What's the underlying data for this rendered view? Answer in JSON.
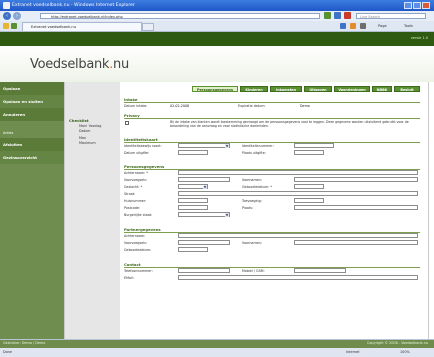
{
  "window": {
    "title": "Extranet voedselbank.nu - Windows Internet Explorer"
  },
  "address": {
    "url": "http://extranet.voedselbank.nl/index.php",
    "search_placeholder": "Live Search"
  },
  "tabs_browser": {
    "active": "Extranet voedselbank.nu"
  },
  "commands": {
    "page": "Page",
    "tools": "Tools"
  },
  "site": {
    "logo_main": "Voedselbank",
    "logo_dot": ".",
    "logo_tld": "nu",
    "version": "versie 1.0"
  },
  "sidebar": {
    "items": [
      {
        "label": "Opslaan"
      },
      {
        "label": "Opslaan en sluiten"
      },
      {
        "label": "Annuleren"
      },
      {
        "label": "Acties"
      },
      {
        "label": "Afsluiten"
      },
      {
        "label": "Gezinsoverzicht"
      }
    ]
  },
  "subpanel": {
    "heading": "Checklist",
    "items": [
      "Man! Voorlag",
      "Datum",
      "Man",
      "Maximum"
    ]
  },
  "main": {
    "tabs": [
      "Persoonsgegevens",
      "Kinderen",
      "Inkomsten",
      "Uitgaven",
      "Voorzieningen",
      "NBBK",
      "Besluit"
    ],
    "intake": {
      "title": "Intake",
      "date_label": "Datum intake:",
      "date_value": "02-02-2008",
      "expire_label": "Expiratie datum:",
      "expire_value": "Demo"
    },
    "privacy": {
      "title": "Privacy",
      "text": "Bij de intake van klanten wordt toestemming gevraagd om de persoonsgegevens vast te leggen. Deze gegevens worden uitsluitend gebruikt voor de beoordeling van de aanvraag en voor statistische doeleinden."
    },
    "identity": {
      "title": "Identiteitskaart",
      "kind_label": "Identiteitsbewijs soort:",
      "number_label": "Identiteitsnummer:",
      "issue_label": "Datum uitgifte:",
      "place_label": "Plaats uitgifte:"
    },
    "person": {
      "title": "Persoonsgegevens",
      "rows": [
        "Achternaam: *",
        "Voorvoegsels:",
        "Geslacht: *",
        "Straat:",
        "Huisnummer:",
        "Postcode:",
        "Burgerlijke staat:"
      ],
      "right_rows": [
        "Voornamen:",
        "Geboortedatum: *",
        "Toevoeging:",
        "Plaats:"
      ]
    },
    "partner": {
      "title": "Partnergegevens",
      "rows": [
        "Achternaam:",
        "Voorvoegsels:",
        "Geboortedatum:"
      ],
      "right_rows": [
        "Voornamen:"
      ]
    },
    "contact": {
      "title": "Contact",
      "rows": [
        "Telefoonnummer:",
        "EMail:"
      ],
      "right_rows": [
        "Mobiel / GSM:"
      ]
    }
  },
  "status": {
    "left_dark": "Gebruiker: Demo / Demo",
    "right_dark": "Copyright © 2008 - Voedselbank.nu",
    "bar": "Done",
    "zone": "Internet",
    "zoom": "100%"
  }
}
